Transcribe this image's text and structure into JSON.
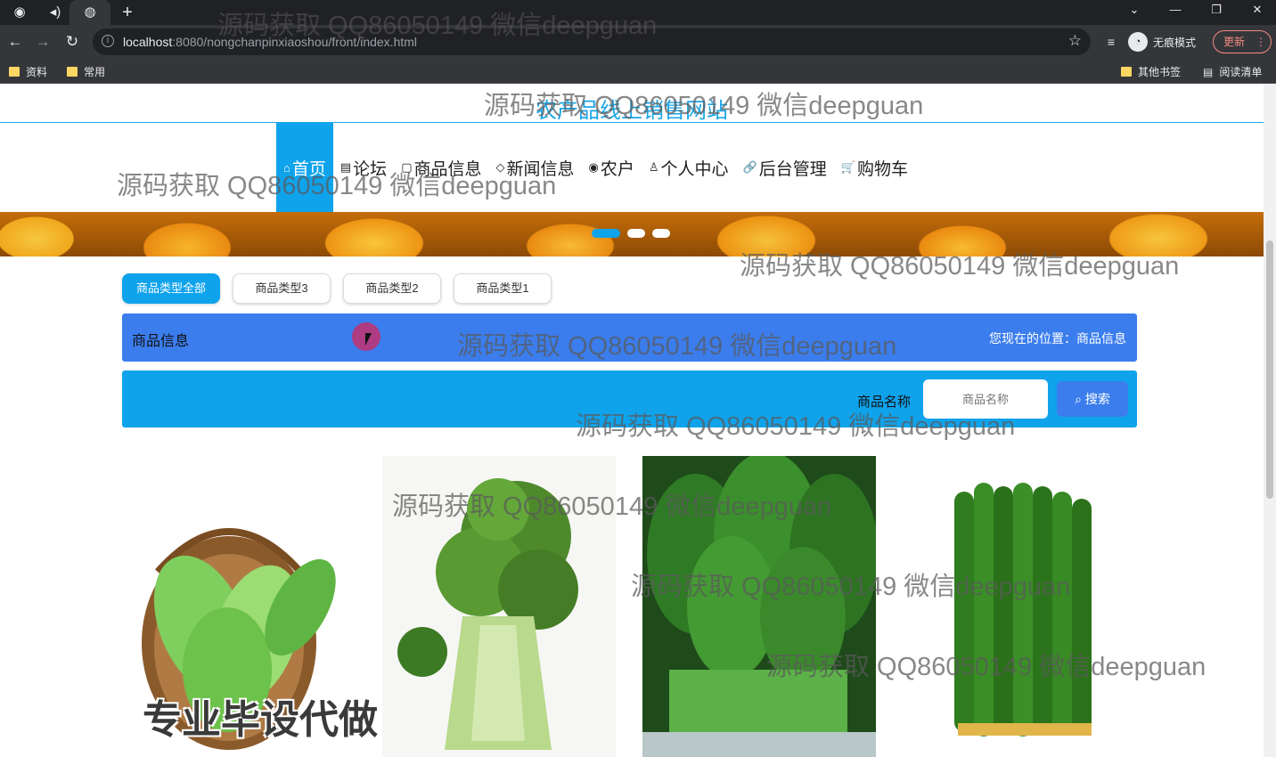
{
  "browser": {
    "tabs": [
      "chrome-icon",
      "audio-icon",
      "globe-icon"
    ],
    "new_tab": "+",
    "url_host": "localhost",
    "url_rest": ":8080/nongchanpinxiaoshou/front/index.html",
    "incognito_label": "无痕模式",
    "update_label": "更新",
    "bookmarks": [
      "资料",
      "常用"
    ],
    "bookmarks_right": [
      "其他书签",
      "阅读清单"
    ]
  },
  "site": {
    "title": "农产品线上销售网站",
    "nav": [
      {
        "icon": "⌂",
        "label": "首页"
      },
      {
        "icon": "▤",
        "label": "论坛"
      },
      {
        "icon": "▢",
        "label": "商品信息"
      },
      {
        "icon": "◇",
        "label": "新闻信息"
      },
      {
        "icon": "◉",
        "label": "农户"
      },
      {
        "icon": "♙",
        "label": "个人中心"
      },
      {
        "icon": "🔗",
        "label": "后台管理"
      },
      {
        "icon": "🛒",
        "label": "购物车"
      }
    ],
    "carousel_active_index": 0,
    "categories": [
      "商品类型全部",
      "商品类型3",
      "商品类型2",
      "商品类型1"
    ],
    "section_title": "商品信息",
    "breadcrumb": "您现在的位置：商品信息",
    "search": {
      "label": "商品名称",
      "placeholder": "商品名称",
      "button": "搜索"
    },
    "products": [
      "bitter-melon",
      "broccoli",
      "spinach",
      "cucumber"
    ]
  },
  "watermark": {
    "text": "源码获取 QQ86050149 微信deepguan",
    "caption": "专业毕设代做"
  },
  "colors": {
    "accent": "#0fa3ec",
    "bar_blue": "#3b7ded",
    "chrome_dark": "#202124",
    "chrome_mid": "#35363a"
  }
}
